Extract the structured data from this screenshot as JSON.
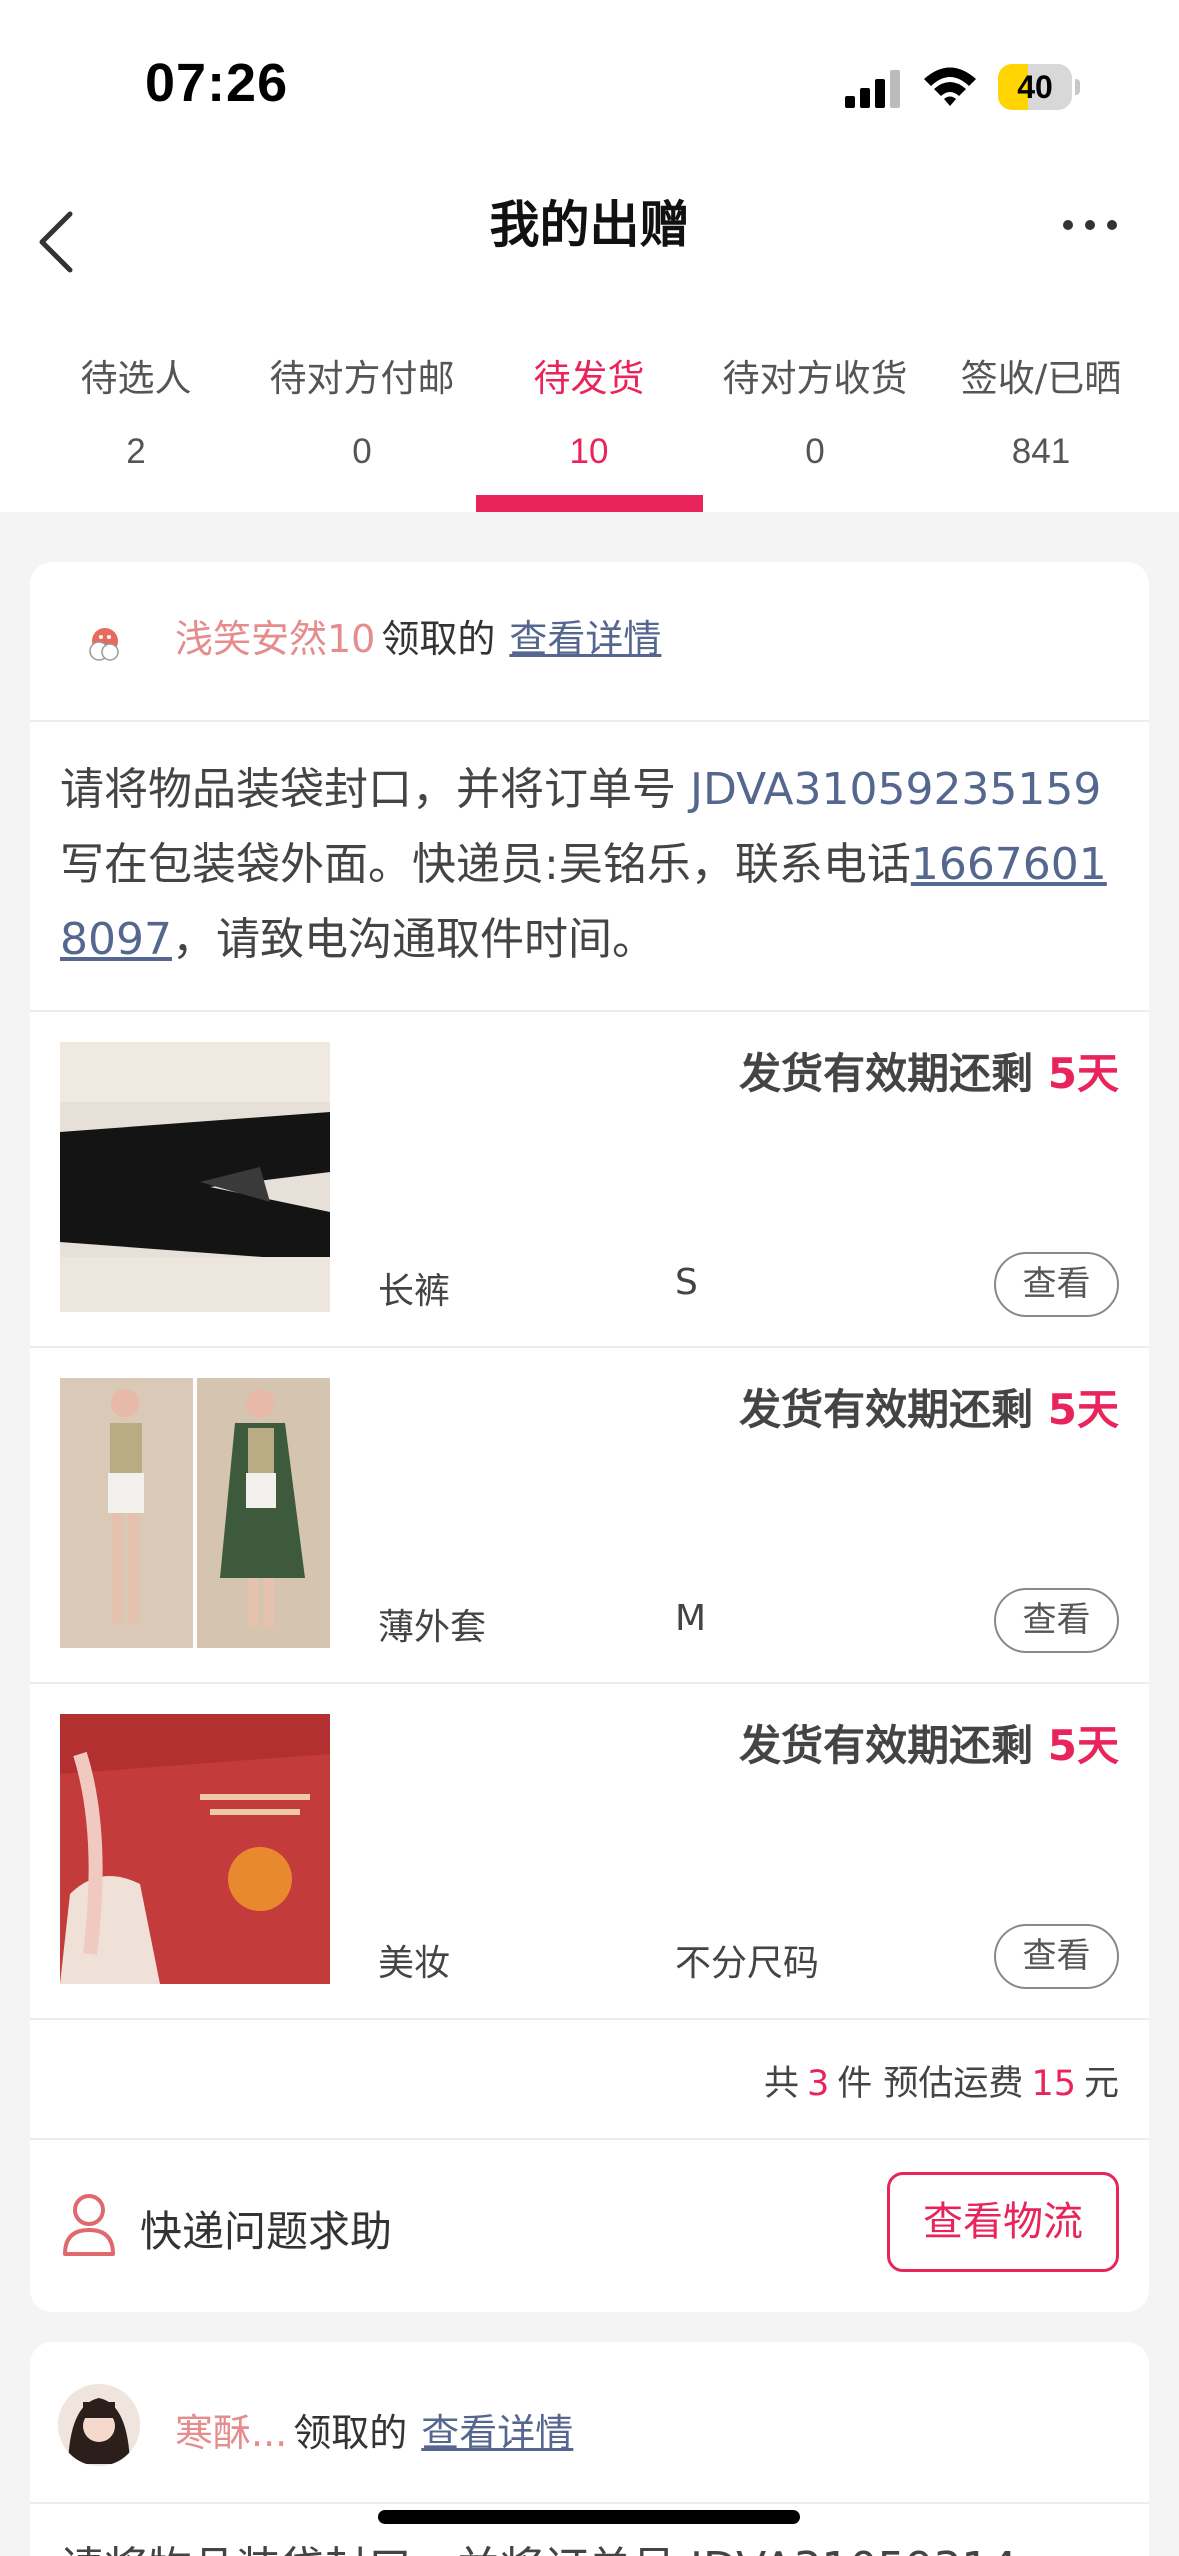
{
  "status_bar": {
    "time": "07:26",
    "battery": "40",
    "battery_level_percent": 40,
    "icons": [
      "signal-icon",
      "wifi-icon",
      "battery-icon"
    ]
  },
  "header": {
    "title": "我的出赠",
    "back_icon": "chevron-left-icon",
    "more_icon": "more-dots-icon"
  },
  "tabs": [
    {
      "label": "待选人",
      "count": "2"
    },
    {
      "label": "待对方付邮",
      "count": "0"
    },
    {
      "label": "待发货",
      "count": "10",
      "active": true
    },
    {
      "label": "待对方收货",
      "count": "0"
    },
    {
      "label": "签收/已晒",
      "count": "841"
    }
  ],
  "colors": {
    "accent": "#e8245b",
    "link": "#55678f",
    "receiver_name": "#e58c8c",
    "background": "#f4f4f4"
  },
  "card1": {
    "receiver_icon": "mascot-icon",
    "receiver": "浅笑安然10",
    "claimed": "领取的",
    "detail_link": "查看详情",
    "instructions": {
      "part1": "请将物品装袋封口，并将订单号 ",
      "order_number": "JDVA31059235159",
      "part2": " 写在包装袋外面。快递员:吴铭乐，联系电话",
      "phone": "16676018097",
      "part3": "，请致电沟通取件时间。"
    },
    "items": [
      {
        "validity_label": "发货有效期还剩 ",
        "days": "5天",
        "category": "长裤",
        "size": "S",
        "view": "查看"
      },
      {
        "validity_label": "发货有效期还剩 ",
        "days": "5天",
        "category": "薄外套",
        "size": "M",
        "view": "查看"
      },
      {
        "validity_label": "发货有效期还剩 ",
        "days": "5天",
        "category": "美妆",
        "size": "不分尺码",
        "view": "查看"
      }
    ],
    "summary": {
      "prefix": "共",
      "count": "3",
      "middle": "件 预估运费",
      "fee": "15",
      "unit": "元"
    },
    "help_icon": "person-icon",
    "help_label": "快递问题求助",
    "logistics_button": "查看物流"
  },
  "card2": {
    "receiver": "寒酥...",
    "claimed": "领取的",
    "detail_link": "查看详情",
    "instructions_partial": "请将物品装袋封口，并将订单号 JDVA31059314"
  }
}
